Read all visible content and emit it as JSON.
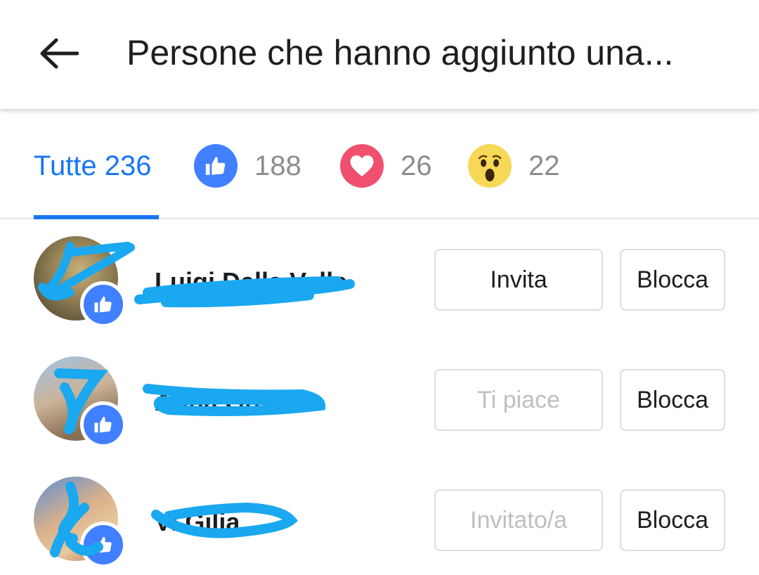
{
  "header": {
    "title": "Persone che hanno aggiunto una..."
  },
  "tabs": {
    "all": {
      "label": "Tutte 236"
    },
    "like": {
      "count": "188"
    },
    "love": {
      "count": "26"
    },
    "wow": {
      "count": "22"
    }
  },
  "people": [
    {
      "name": "Luigi Della Valle",
      "action_label": "Invita",
      "block_label": "Blocca"
    },
    {
      "name": "Anna Grazi",
      "action_label": "Ti piace",
      "block_label": "Blocca"
    },
    {
      "name": "Vi Gilia",
      "action_label": "Invitato/a",
      "block_label": "Blocca"
    }
  ],
  "colors": {
    "accent": "#1877f2",
    "like": "#4080ff",
    "love": "#f0506e",
    "wow": "#f7d857",
    "scribble": "#1aa8f0"
  }
}
